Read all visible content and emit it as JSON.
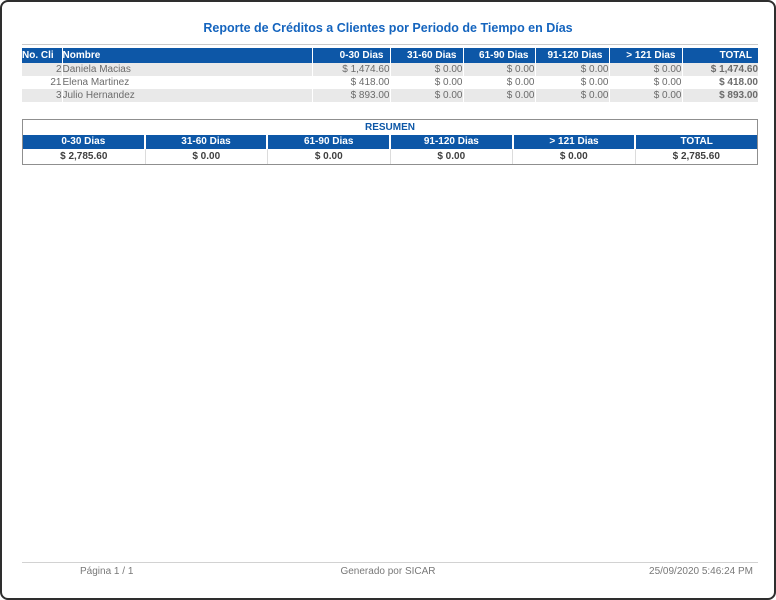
{
  "report": {
    "title": "Reporte de Créditos a Clientes por Periodo de Tiempo en Días"
  },
  "main_table": {
    "columns": [
      "No. Cli",
      "Nombre",
      "0-30 Dias",
      "31-60 Dias",
      "61-90 Dias",
      "91-120 Dias",
      "> 121 Dias",
      "TOTAL"
    ],
    "rows": [
      [
        "2",
        "Daniela Macias",
        "$ 1,474.60",
        "$ 0.00",
        "$ 0.00",
        "$ 0.00",
        "$ 0.00",
        "$ 1,474.60"
      ],
      [
        "21",
        "Elena Martinez",
        "$ 418.00",
        "$ 0.00",
        "$ 0.00",
        "$ 0.00",
        "$ 0.00",
        "$ 418.00"
      ],
      [
        "3",
        "Julio Hernandez",
        "$ 893.00",
        "$ 0.00",
        "$ 0.00",
        "$ 0.00",
        "$ 0.00",
        "$ 893.00"
      ]
    ]
  },
  "resumen": {
    "title": "RESUMEN",
    "columns": [
      "0-30 Dias",
      "31-60 Dias",
      "61-90 Dias",
      "91-120 Dias",
      "> 121 Dias",
      "TOTAL"
    ],
    "values": [
      "$ 2,785.60",
      "$ 0.00",
      "$ 0.00",
      "$ 0.00",
      "$ 0.00",
      "$ 2,785.60"
    ]
  },
  "footer": {
    "page_label": "Página 1 / 1",
    "generated_by": "Generado por SICAR",
    "datetime": "25/09/2020 5:46:24 PM"
  },
  "colors": {
    "accent_blue": "#0D57A7",
    "title_blue": "#1464BE",
    "stripe_gray": "#E9E9E9",
    "total_text": "#1D1D1D",
    "body_text_gray": "#6B6B6B",
    "footer_text_gray": "#787878"
  }
}
